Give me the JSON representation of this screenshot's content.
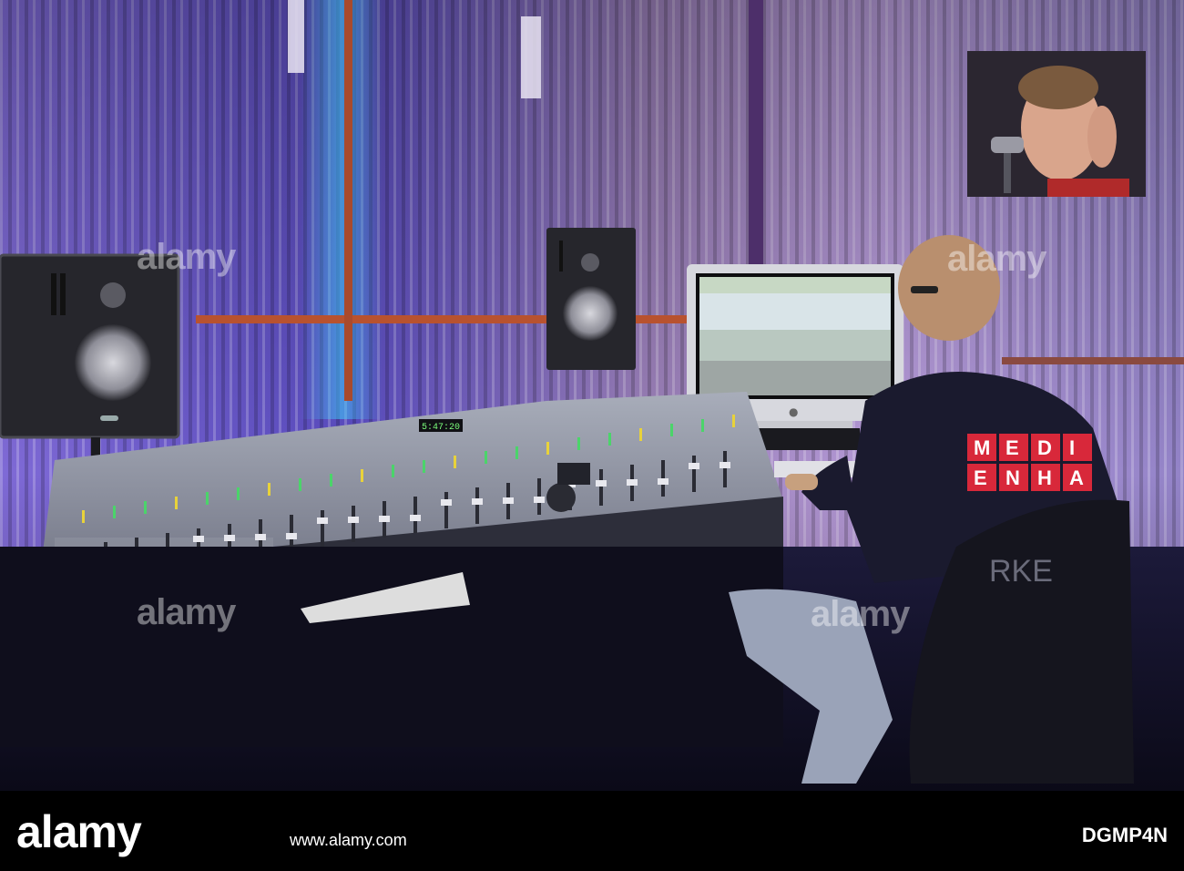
{
  "scene": {
    "description_hidden": false,
    "shirt_letters_row1": [
      "M",
      "E",
      "D",
      "I"
    ],
    "shirt_letters_row2": [
      "E",
      "N",
      "H",
      "A"
    ],
    "chair_text": "RKE",
    "console_clock": "5:47:20",
    "monitor_brand_icon": "apple-logo-icon",
    "colors": {
      "wall_purple": "#6c4fc9",
      "wall_orange": "#c58a5a",
      "shirt_red": "#d8283a",
      "console_gray": "#8a8d98"
    }
  },
  "watermarks": [
    "alamy",
    "alamy",
    "alamy",
    "alamy"
  ],
  "footer": {
    "logo": "alamy",
    "url": "www.alamy.com",
    "image_id": "DGMP4N"
  }
}
